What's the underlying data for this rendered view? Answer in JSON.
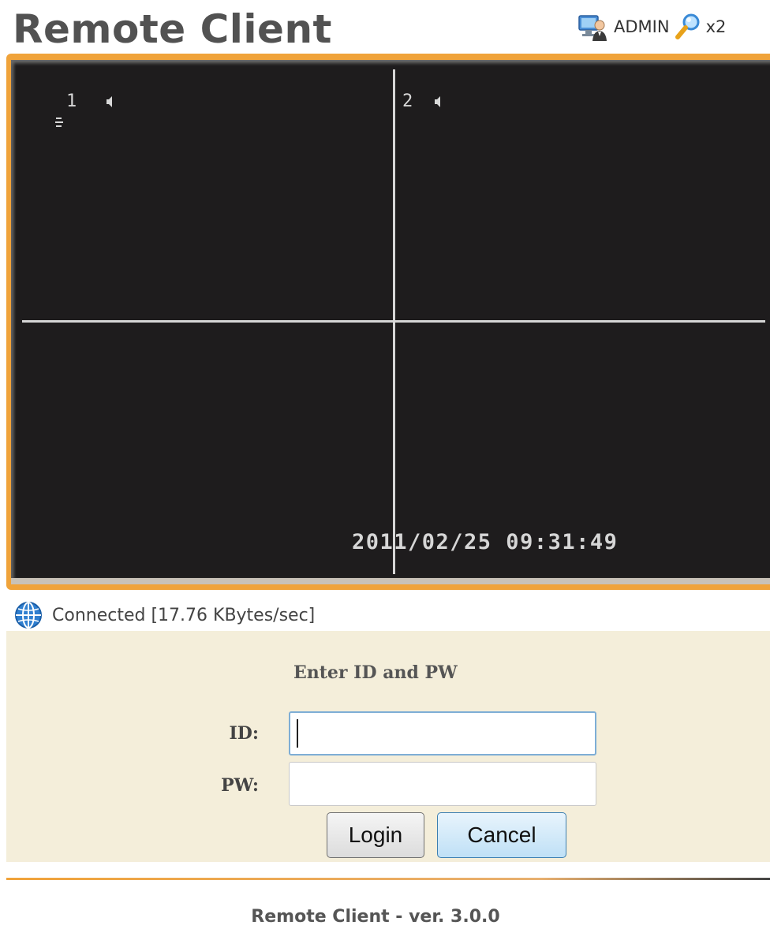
{
  "header": {
    "title": "Remote Client",
    "user_label": "ADMIN",
    "zoom_label": "x2",
    "user_icon": "user-admin-icon",
    "zoom_icon": "magnifier-icon"
  },
  "viewer": {
    "camera_1_label": "1",
    "camera_2_label": "2",
    "timestamp": "2011/02/25 09:31:49",
    "speaker_icon": "speaker-icon",
    "frame_color": "#f0a33a",
    "background_color": "#1e1c1d"
  },
  "status": {
    "icon": "globe-icon",
    "text": "Connected [17.76 KBytes/sec]"
  },
  "login": {
    "title": "Enter ID and PW",
    "id_label": "ID:",
    "pw_label": "PW:",
    "id_value": "",
    "pw_value": "",
    "login_button": "Login",
    "cancel_button": "Cancel",
    "panel_color": "#f4eeda"
  },
  "footer": {
    "text": "Remote Client - ver. 3.0.0"
  }
}
